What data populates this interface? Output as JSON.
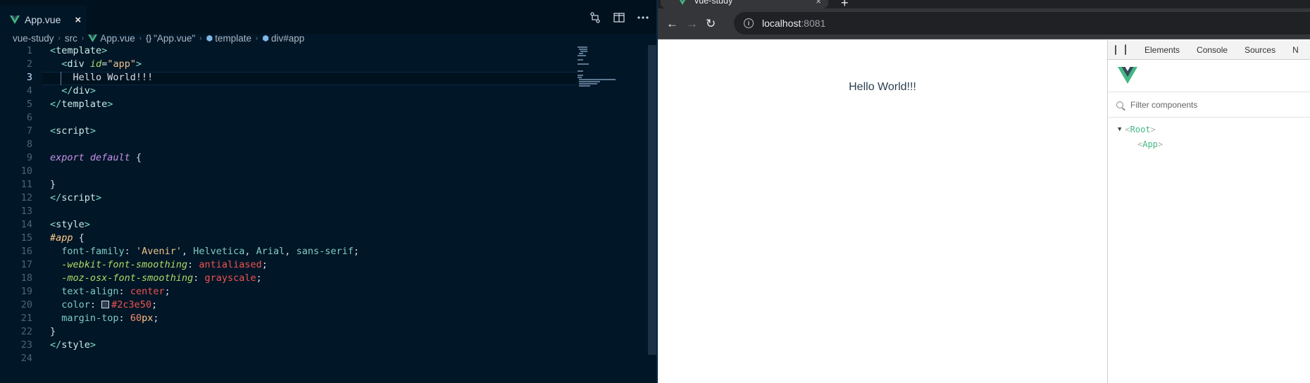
{
  "editor": {
    "tab": {
      "label": "App.vue",
      "close": "×"
    },
    "actions": [
      "compare-changes",
      "split-editor",
      "more"
    ],
    "breadcrumb": [
      "vue-study",
      "src",
      "App.vue",
      "\"App.vue\"",
      "template",
      "div#app"
    ],
    "active_line": 3,
    "lines": [
      {
        "n": "1",
        "tokens": [
          [
            "t-br",
            "<"
          ],
          [
            "t-tag",
            "template"
          ],
          [
            "t-br",
            ">"
          ]
        ]
      },
      {
        "n": "2",
        "tokens": [
          [
            "t-plain",
            "  "
          ],
          [
            "t-br",
            "<"
          ],
          [
            "t-tag",
            "div "
          ],
          [
            "t-attr",
            "id"
          ],
          [
            "t-plain",
            "="
          ],
          [
            "t-str",
            "\"app\""
          ],
          [
            "t-br",
            ">"
          ]
        ]
      },
      {
        "n": "3",
        "tokens": [
          [
            "t-plain",
            "    Hello World!!!"
          ]
        ]
      },
      {
        "n": "4",
        "tokens": [
          [
            "t-plain",
            "  "
          ],
          [
            "t-br",
            "</"
          ],
          [
            "t-tag",
            "div"
          ],
          [
            "t-br",
            ">"
          ]
        ]
      },
      {
        "n": "5",
        "tokens": [
          [
            "t-br",
            "</"
          ],
          [
            "t-tag",
            "template"
          ],
          [
            "t-br",
            ">"
          ]
        ]
      },
      {
        "n": "6",
        "tokens": []
      },
      {
        "n": "7",
        "tokens": [
          [
            "t-br",
            "<"
          ],
          [
            "t-tag",
            "script"
          ],
          [
            "t-br",
            ">"
          ]
        ]
      },
      {
        "n": "8",
        "tokens": []
      },
      {
        "n": "9",
        "tokens": [
          [
            "t-kw",
            "export default "
          ],
          [
            "t-plain",
            "{"
          ]
        ]
      },
      {
        "n": "10",
        "tokens": []
      },
      {
        "n": "11",
        "tokens": [
          [
            "t-plain",
            "}"
          ]
        ]
      },
      {
        "n": "12",
        "tokens": [
          [
            "t-br",
            "</"
          ],
          [
            "t-tag",
            "script"
          ],
          [
            "t-br",
            ">"
          ]
        ]
      },
      {
        "n": "13",
        "tokens": []
      },
      {
        "n": "14",
        "tokens": [
          [
            "t-br",
            "<"
          ],
          [
            "t-tag",
            "style"
          ],
          [
            "t-br",
            ">"
          ]
        ]
      },
      {
        "n": "15",
        "tokens": [
          [
            "t-sel",
            "#app"
          ],
          [
            "t-plain",
            " {"
          ]
        ]
      },
      {
        "n": "16",
        "tokens": [
          [
            "t-plain",
            "  "
          ],
          [
            "t-prop",
            "font-family"
          ],
          [
            "t-plain",
            ": "
          ],
          [
            "t-str",
            "'Avenir'"
          ],
          [
            "t-plain",
            ", "
          ],
          [
            "t-prop",
            "Helvetica"
          ],
          [
            "t-plain",
            ", "
          ],
          [
            "t-prop",
            "Arial"
          ],
          [
            "t-plain",
            ", "
          ],
          [
            "t-prop",
            "sans-serif"
          ],
          [
            "t-plain",
            ";"
          ]
        ]
      },
      {
        "n": "17",
        "tokens": [
          [
            "t-plain",
            "  "
          ],
          [
            "t-attr",
            "-webkit-font-smoothing"
          ],
          [
            "t-plain",
            ": "
          ],
          [
            "t-val",
            "antialiased"
          ],
          [
            "t-plain",
            ";"
          ]
        ]
      },
      {
        "n": "18",
        "tokens": [
          [
            "t-plain",
            "  "
          ],
          [
            "t-attr",
            "-moz-osx-font-smoothing"
          ],
          [
            "t-plain",
            ": "
          ],
          [
            "t-val",
            "grayscale"
          ],
          [
            "t-plain",
            ";"
          ]
        ]
      },
      {
        "n": "19",
        "tokens": [
          [
            "t-plain",
            "  "
          ],
          [
            "t-prop",
            "text-align"
          ],
          [
            "t-plain",
            ": "
          ],
          [
            "t-val",
            "center"
          ],
          [
            "t-plain",
            ";"
          ]
        ]
      },
      {
        "n": "20",
        "tokens": [
          [
            "t-plain",
            "  "
          ],
          [
            "t-prop",
            "color"
          ],
          [
            "t-plain",
            ": "
          ],
          [
            "swatch",
            ""
          ],
          [
            "t-val",
            "#2c3e50"
          ],
          [
            "t-plain",
            ";"
          ]
        ]
      },
      {
        "n": "21",
        "tokens": [
          [
            "t-plain",
            "  "
          ],
          [
            "t-prop",
            "margin-top"
          ],
          [
            "t-plain",
            ": "
          ],
          [
            "t-num",
            "60"
          ],
          [
            "t-unit",
            "px"
          ],
          [
            "t-plain",
            ";"
          ]
        ]
      },
      {
        "n": "22",
        "tokens": [
          [
            "t-plain",
            "}"
          ]
        ]
      },
      {
        "n": "23",
        "tokens": [
          [
            "t-br",
            "</"
          ],
          [
            "t-tag",
            "style"
          ],
          [
            "t-br",
            ">"
          ]
        ]
      },
      {
        "n": "24",
        "tokens": []
      }
    ]
  },
  "browser": {
    "tab": {
      "title": "vue-study",
      "close": "×"
    },
    "new_tab": "+",
    "nav": {
      "back": "←",
      "forward": "→",
      "reload": "↻"
    },
    "url": {
      "host": "localhost",
      "port": ":8081"
    },
    "page_text": "Hello World!!!",
    "devtools": {
      "tabs": [
        "Elements",
        "Console",
        "Sources",
        "N"
      ],
      "filter_placeholder": "Filter components",
      "tree": [
        {
          "name": "Root",
          "expanded": true,
          "depth": 0
        },
        {
          "name": "App",
          "expanded": false,
          "depth": 1
        }
      ]
    }
  },
  "colors": {
    "vue_green": "#42b983",
    "vue_dark": "#35495e",
    "editor_bg": "#011627"
  }
}
